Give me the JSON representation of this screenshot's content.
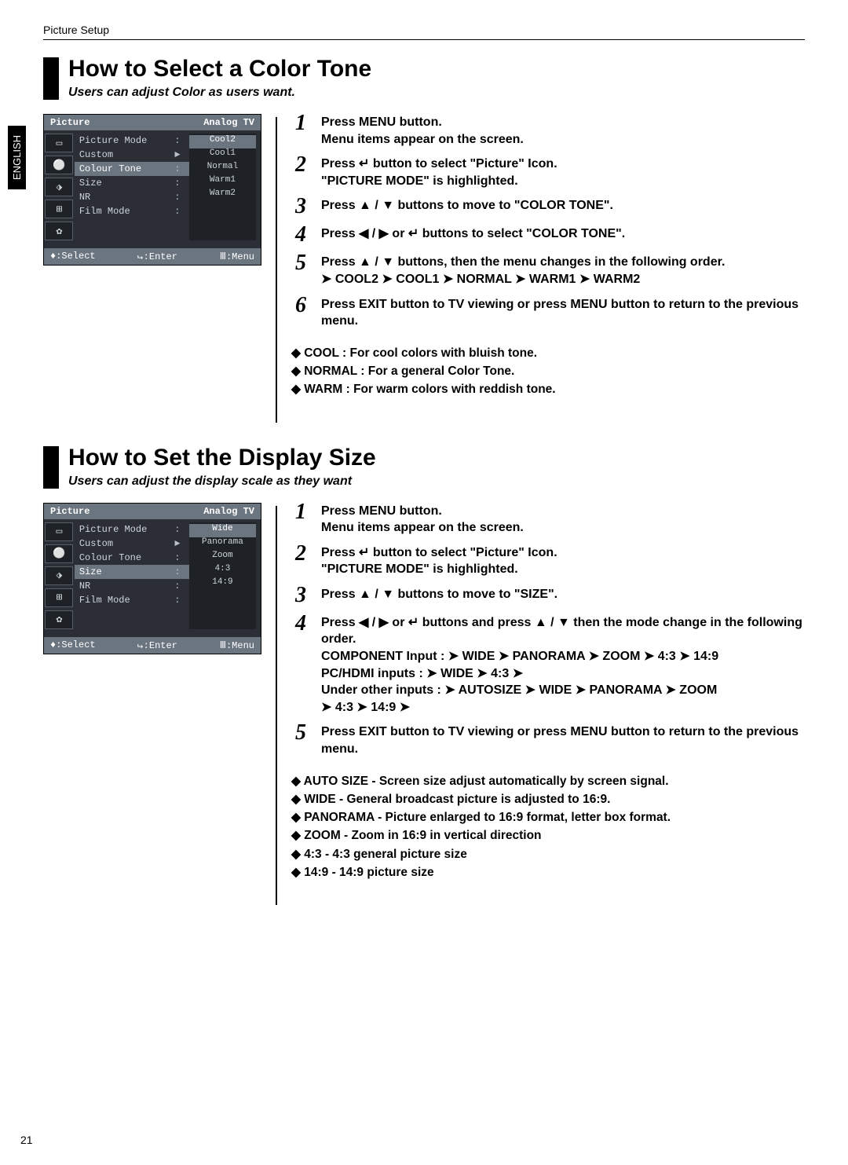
{
  "page": {
    "running": "Picture Setup",
    "lang_tab": "ENGLISH",
    "number": "21"
  },
  "symbols": {
    "up": "▲",
    "down": "▼",
    "left": "◀",
    "right": "▶",
    "enter": "↵",
    "arrow": "➤",
    "menu": "Ⅲ",
    "move": "♦"
  },
  "section1": {
    "title": "How to Select a Color Tone",
    "subtitle": "Users can adjust Color as users want.",
    "osd": {
      "header_left": "Picture",
      "header_right": "Analog TV",
      "icons": [
        "▭",
        "⚪",
        "⬗",
        "⊞",
        "✿"
      ],
      "rows": [
        {
          "name": "Picture Mode",
          "mid": ":",
          "hl": false
        },
        {
          "name": "Custom",
          "mid": "►",
          "hl": false
        },
        {
          "name": "Colour Tone",
          "mid": ":",
          "hl": true
        },
        {
          "name": "Size",
          "mid": ":",
          "hl": false
        },
        {
          "name": "NR",
          "mid": ":",
          "hl": false
        },
        {
          "name": "Film Mode",
          "mid": ":",
          "hl": false
        }
      ],
      "menu": [
        {
          "label": "Cool2",
          "hl": true
        },
        {
          "label": "Cool1",
          "hl": false
        },
        {
          "label": "Normal",
          "hl": false
        },
        {
          "label": "Warm1",
          "hl": false
        },
        {
          "label": "Warm2",
          "hl": false
        }
      ],
      "footer": {
        "select": ":Select",
        "enter": ":Enter",
        "menu": ":Menu"
      }
    },
    "steps": [
      {
        "n": "1",
        "t": "Press MENU button.\nMenu items appear on the screen."
      },
      {
        "n": "2",
        "t": "Press ↵ button to select \"Picture\" Icon.\n\"PICTURE MODE\" is highlighted."
      },
      {
        "n": "3",
        "t": "Press ▲ / ▼ buttons to move to \"COLOR TONE\"."
      },
      {
        "n": "4",
        "t": "Press ◀ / ▶ or ↵ buttons to select \"COLOR TONE\"."
      },
      {
        "n": "5",
        "t": "Press ▲ / ▼ buttons, then the menu changes in the following order.\n➤ COOL2 ➤ COOL1 ➤ NORMAL ➤ WARM1 ➤ WARM2"
      },
      {
        "n": "6",
        "t": "Press EXIT button to TV viewing or press MENU button to return to the previous menu."
      }
    ],
    "notes": [
      "COOL : For cool colors with bluish tone.",
      "NORMAL : For a general Color Tone.",
      "WARM : For warm colors with reddish tone."
    ]
  },
  "section2": {
    "title": "How to Set the Display Size",
    "subtitle": "Users can adjust the display scale as they want",
    "osd": {
      "header_left": "Picture",
      "header_right": "Analog TV",
      "icons": [
        "▭",
        "⚪",
        "⬗",
        "⊞",
        "✿"
      ],
      "rows": [
        {
          "name": "Picture Mode",
          "mid": ":",
          "hl": false
        },
        {
          "name": "Custom",
          "mid": "►",
          "hl": false
        },
        {
          "name": "Colour Tone",
          "mid": ":",
          "hl": false
        },
        {
          "name": "Size",
          "mid": ":",
          "hl": true
        },
        {
          "name": "NR",
          "mid": ":",
          "hl": false
        },
        {
          "name": "Film Mode",
          "mid": ":",
          "hl": false
        }
      ],
      "menu": [
        {
          "label": "Wide",
          "hl": true
        },
        {
          "label": "Panorama",
          "hl": false
        },
        {
          "label": "Zoom",
          "hl": false
        },
        {
          "label": "4:3",
          "hl": false
        },
        {
          "label": "14:9",
          "hl": false
        }
      ],
      "footer": {
        "select": ":Select",
        "enter": ":Enter",
        "menu": ":Menu"
      }
    },
    "steps": [
      {
        "n": "1",
        "t": "Press MENU button.\nMenu items appear on the screen."
      },
      {
        "n": "2",
        "t": "Press ↵ button to select \"Picture\" Icon.\n\"PICTURE MODE\" is highlighted."
      },
      {
        "n": "3",
        "t": "Press ▲ / ▼ buttons to move to \"SIZE\"."
      },
      {
        "n": "4",
        "t": "Press ◀ / ▶ or ↵ buttons and press ▲ / ▼ then the mode change in the following order.\nCOMPONENT Input : ➤ WIDE ➤ PANORAMA ➤ ZOOM ➤ 4:3 ➤ 14:9\nPC/HDMI inputs : ➤ WIDE ➤ 4:3 ➤\nUnder other inputs : ➤ AUTOSIZE ➤ WIDE ➤ PANORAMA ➤ ZOOM\n                                       ➤ 4:3 ➤ 14:9 ➤"
      },
      {
        "n": "5",
        "t": "Press EXIT button to TV viewing or press MENU button to return to the previous menu."
      }
    ],
    "notes": [
      "AUTO SIZE - Screen size adjust automatically by screen signal.",
      "WIDE - General broadcast picture is adjusted to 16:9.",
      "PANORAMA - Picture enlarged to 16:9 format, letter box format.",
      "ZOOM - Zoom in 16:9 in vertical direction",
      "4:3 - 4:3 general picture size",
      "14:9 - 14:9 picture size"
    ]
  }
}
